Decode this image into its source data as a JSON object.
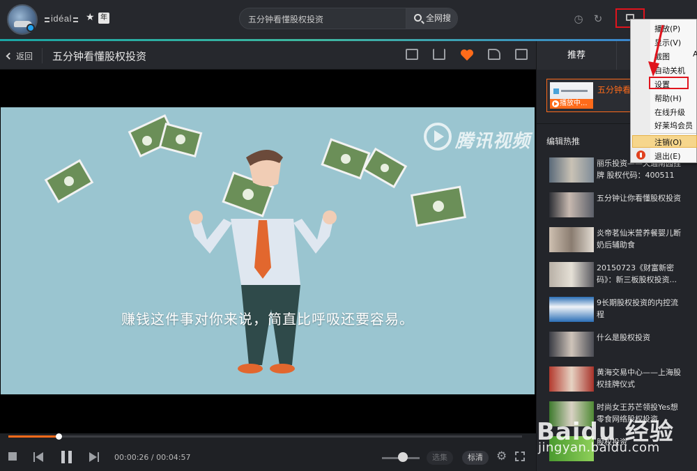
{
  "app": {
    "brand": "idéal",
    "year_badge": "年"
  },
  "search": {
    "query": "五分钟看懂股权投资",
    "button_label": "全网搜"
  },
  "titlebar": {
    "back_label": "返回",
    "video_title": "五分钟看懂股权投资"
  },
  "player": {
    "subtitle": "赚钱这件事对你来说，简直比呼吸还要容易。",
    "watermark": "腾讯视频",
    "current_time": "00:00:26",
    "total_time": "00:04:57",
    "time_sep": " / ",
    "progress": 0.098,
    "volume": 0.55,
    "episode_btn": "选集",
    "quality_btn": "标清"
  },
  "right_panel": {
    "tab_active": "推荐",
    "now_playing_title": "五分钟看懂",
    "now_playing_badge": "播放中...",
    "section_title": "编辑热推",
    "items": [
      {
        "title": "丽乐投资——天通南园挂牌 股权代码：400511"
      },
      {
        "title": "五分钟让你看懂股权投资"
      },
      {
        "title": "炎帝茗仙米营养餐婴儿断奶后辅助食"
      },
      {
        "title": "20150723《财富新密码》：新三板股权投资..."
      },
      {
        "title": "9长期股权投资的内控流程"
      },
      {
        "title": "什么是股权投资"
      },
      {
        "title": "黄海交易中心——上海股权挂牌仪式"
      },
      {
        "title": "时尚女王苏芒领投Yes想零食网络股权投资"
      },
      {
        "title": "股权投资"
      }
    ]
  },
  "context_menu": {
    "items": [
      "播放(P)",
      "显示(V)",
      "截图",
      "自动关机",
      "设置",
      "帮助(H)",
      "在线升级",
      "好莱坞会员",
      "注销(O)",
      "退出(E)"
    ],
    "extra_right": "A"
  },
  "overlay_watermark": {
    "brand": "Baidu 经验",
    "url": "jingyan.baidu.com"
  },
  "colors": {
    "accent": "#ff6b1a",
    "highlight_box": "#e0141d",
    "menu_hover": "#f6d68c"
  }
}
